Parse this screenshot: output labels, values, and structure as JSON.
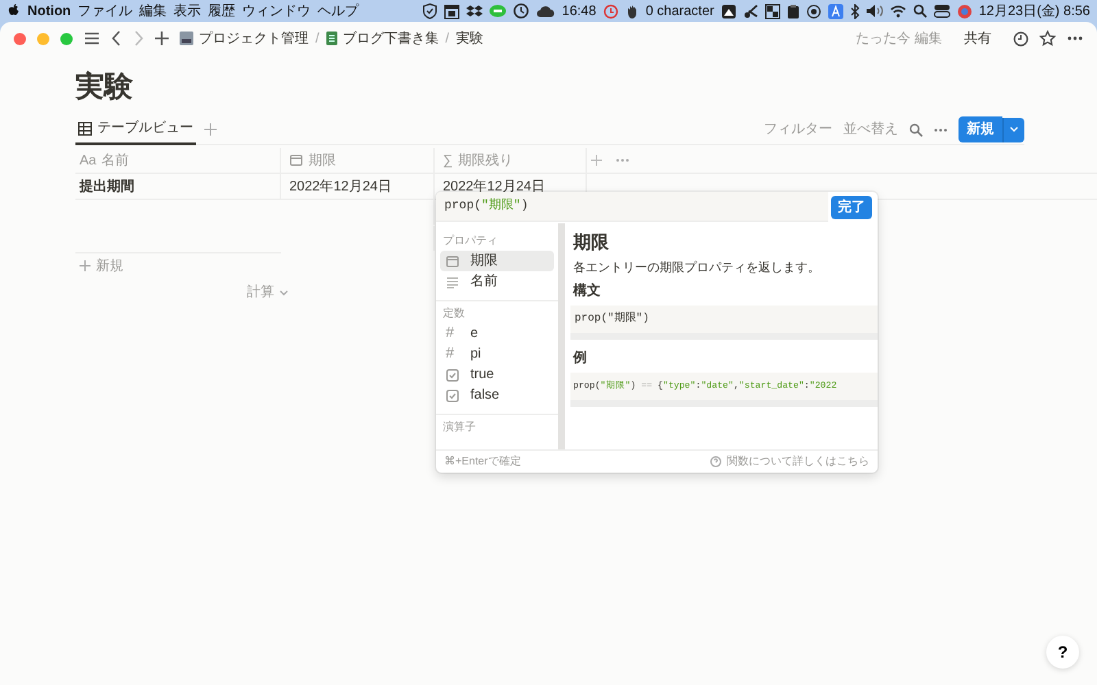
{
  "menu_bar": {
    "app": "Notion",
    "menus": [
      "ファイル",
      "編集",
      "表示",
      "履歴",
      "ウィンドウ",
      "ヘルプ"
    ],
    "clock_status": "16:48",
    "character_count": "0 character",
    "datetime": "12月23日(金) 8:56"
  },
  "breadcrumbs": [
    "プロジェクト管理",
    "ブログ下書き集",
    "実験"
  ],
  "breadcrumb_separator": "/",
  "top_actions": {
    "edited": "たった今 編集",
    "share": "共有"
  },
  "page_title": "実験",
  "views": [
    {
      "label": "テーブルビュー",
      "selected": true
    }
  ],
  "toolbar": {
    "filter": "フィルター",
    "sort": "並べ替え",
    "new": "新規"
  },
  "table": {
    "columns": [
      {
        "kind": "title",
        "glyph": "Aa",
        "label": "名前"
      },
      {
        "kind": "date",
        "label": "期限"
      },
      {
        "kind": "formula",
        "glyph": "∑",
        "label": "期限残り"
      }
    ],
    "rows": [
      {
        "cells": [
          "提出期間",
          "2022年12月24日",
          "2022年12月24日"
        ]
      },
      {},
      {}
    ],
    "add_row": "新規",
    "calculate": "計算"
  },
  "formula_editor": {
    "formula": [
      {
        "kind": "code",
        "text": "prop("
      },
      {
        "kind": "string",
        "text": "\"期限\""
      },
      {
        "kind": "code",
        "text": ")"
      }
    ],
    "done": "完了",
    "sections": [
      {
        "title": "プロパティ",
        "items": [
          {
            "kind": "calendar",
            "label": "期限",
            "selected": true
          },
          {
            "kind": "lines",
            "label": "名前",
            "selected": false
          }
        ]
      },
      {
        "title": "定数",
        "items": [
          {
            "kind": "hash",
            "glyph": "#",
            "label": "e",
            "selected": false
          },
          {
            "kind": "hash",
            "glyph": "#",
            "label": "pi",
            "selected": false
          },
          {
            "kind": "checkbox",
            "label": "true",
            "selected": false
          },
          {
            "kind": "checkbox",
            "label": "false",
            "selected": false
          }
        ]
      },
      {
        "title": "演算子"
      }
    ],
    "detail": {
      "title": "期限",
      "description": "各エントリーの期限プロパティを返します。",
      "syntax_heading": "構文",
      "syntax": [
        {
          "kind": "code",
          "text": "prop(\"期限\")"
        }
      ],
      "example_heading": "例",
      "example": [
        {
          "kind": "code",
          "text": "prop("
        },
        {
          "kind": "string",
          "text": "\"期限\""
        },
        {
          "kind": "code",
          "text": ") "
        },
        {
          "kind": "operator",
          "text": "=="
        },
        {
          "kind": "code",
          "text": " {"
        },
        {
          "kind": "string",
          "text": "\"type\""
        },
        {
          "kind": "code",
          "text": ":"
        },
        {
          "kind": "string",
          "text": "\"date\""
        },
        {
          "kind": "code",
          "text": ","
        },
        {
          "kind": "string",
          "text": "\"start_date\""
        },
        {
          "kind": "code",
          "text": ":"
        },
        {
          "kind": "string",
          "text": "\"2022"
        }
      ]
    },
    "footer": {
      "shortcut": "⌘+Enterで確定",
      "help_link": "関数について詳しくはこちら"
    }
  },
  "help_button": "?"
}
